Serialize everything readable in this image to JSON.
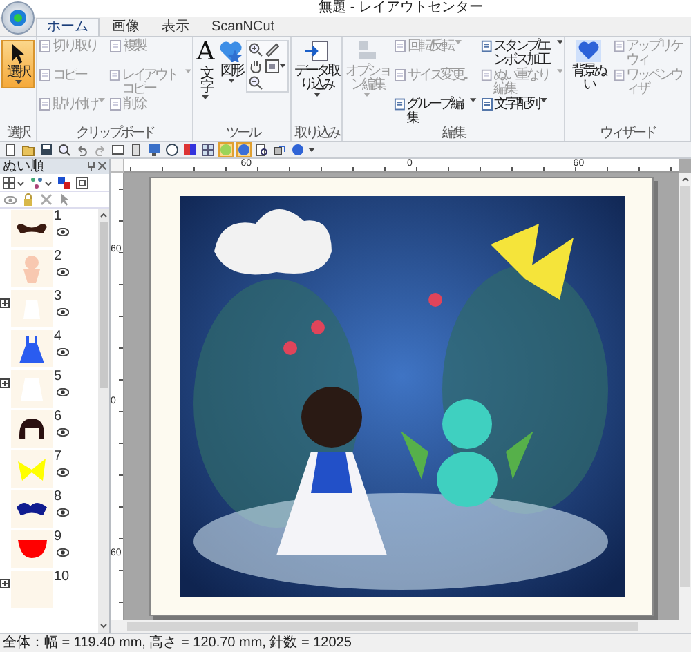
{
  "window": {
    "title": "無題 - レイアウトセンター"
  },
  "tabs": [
    {
      "label": "ホーム",
      "selected": true
    },
    {
      "label": "画像",
      "selected": false
    },
    {
      "label": "表示",
      "selected": false
    },
    {
      "label": "ScanNCut",
      "selected": false
    }
  ],
  "ribbon": [
    {
      "label": "選択",
      "items": [
        {
          "kind": "tool",
          "label": "選択",
          "active": true,
          "dropdown": true
        }
      ]
    },
    {
      "label": "クリップボード",
      "items": [
        {
          "kind": "small",
          "label": "切り取り",
          "disabled": true,
          "dropdown": false
        },
        {
          "kind": "small",
          "label": "コピー",
          "disabled": true,
          "dropdown": false
        },
        {
          "kind": "small",
          "label": "貼り付け",
          "disabled": true,
          "dropdown": true
        },
        {
          "kind": "small",
          "label": "複製",
          "disabled": true,
          "dropdown": false
        },
        {
          "kind": "small",
          "label": "レイアウトコピー",
          "disabled": true,
          "dropdown": true
        },
        {
          "kind": "small",
          "label": "削除",
          "disabled": true,
          "dropdown": false
        }
      ]
    },
    {
      "label": "ツール",
      "items": [
        {
          "kind": "large",
          "label": "文字",
          "glyph": "A",
          "disabled": false,
          "dropdown": true
        },
        {
          "kind": "large",
          "label": "図形",
          "disabled": false,
          "dropdown": true
        },
        {
          "kind": "icon",
          "dropdown": false
        },
        {
          "kind": "icon",
          "dropdown": false
        },
        {
          "kind": "icon",
          "dropdown": false
        },
        {
          "kind": "icon",
          "dropdown": false
        },
        {
          "kind": "icon",
          "dropdown": true
        }
      ]
    },
    {
      "label": "取り込み",
      "items": [
        {
          "kind": "large",
          "label": "データ取り込み",
          "disabled": false,
          "dropdown": true
        }
      ]
    },
    {
      "label": "編集",
      "items": [
        {
          "kind": "large",
          "label": "オプション編集",
          "disabled": true,
          "dropdown": true
        },
        {
          "kind": "small",
          "label": "回転/反転",
          "disabled": true,
          "dropdown": true
        },
        {
          "kind": "small",
          "label": "サイズ変更...",
          "disabled": true,
          "dropdown": false
        },
        {
          "kind": "small",
          "label": "グループ編集",
          "disabled": false,
          "dropdown": true
        },
        {
          "kind": "small",
          "label": "スタンプ/エンボス加工",
          "disabled": false,
          "dropdown": true
        },
        {
          "kind": "small",
          "label": "ぬい重なり編集",
          "disabled": true,
          "dropdown": true
        },
        {
          "kind": "small",
          "label": "文字配列",
          "disabled": false,
          "dropdown": true
        }
      ]
    },
    {
      "label": "ウィザード",
      "items": [
        {
          "kind": "large",
          "label": "背景ぬい",
          "disabled": false,
          "dropdown": false
        },
        {
          "kind": "small",
          "label": "アップリケウィ",
          "disabled": true,
          "dropdown": false
        },
        {
          "kind": "small",
          "label": "ワッペンウィザ",
          "disabled": true,
          "dropdown": false
        }
      ]
    }
  ],
  "quick_toolbar": [
    {
      "active": false
    },
    {
      "active": false
    },
    {
      "active": false
    },
    {
      "active": false
    },
    {
      "active": false
    },
    {
      "active": false
    },
    {
      "active": false
    },
    {
      "active": false
    },
    {
      "active": false
    },
    {
      "active": false
    },
    {
      "active": false
    },
    {
      "active": false
    },
    {
      "active": true
    },
    {
      "active": true
    },
    {
      "active": false
    },
    {
      "active": false
    },
    {
      "active": false
    }
  ],
  "sewing_order_panel": {
    "title": "ぬい順",
    "items": [
      {
        "number": "1",
        "color": "#3a1a10",
        "expandable": false,
        "visible": true
      },
      {
        "number": "2",
        "color": "#f8c8b0",
        "expandable": false,
        "visible": true
      },
      {
        "number": "3",
        "color": "#ffffff",
        "expandable": true,
        "visible": true
      },
      {
        "number": "4",
        "color": "#2a5cf0",
        "expandable": false,
        "visible": true
      },
      {
        "number": "5",
        "color": "#ffffff",
        "expandable": true,
        "visible": true
      },
      {
        "number": "6",
        "color": "#2a1010",
        "expandable": false,
        "visible": true
      },
      {
        "number": "7",
        "color": "#ffff00",
        "expandable": false,
        "visible": true
      },
      {
        "number": "8",
        "color": "#101c90",
        "expandable": false,
        "visible": true
      },
      {
        "number": "9",
        "color": "#ff0000",
        "expandable": false,
        "visible": true
      },
      {
        "number": "10",
        "expandable": true
      }
    ]
  },
  "canvas": {
    "horizontal_ruler": [
      "60",
      "0",
      "60"
    ],
    "vertical_ruler": [
      "60",
      "0",
      "60"
    ],
    "design": {
      "kind": "picture"
    }
  },
  "status_bar": "全体：幅 = 119.40 mm, 高さ = 120.70 mm, 針数 = 12025"
}
